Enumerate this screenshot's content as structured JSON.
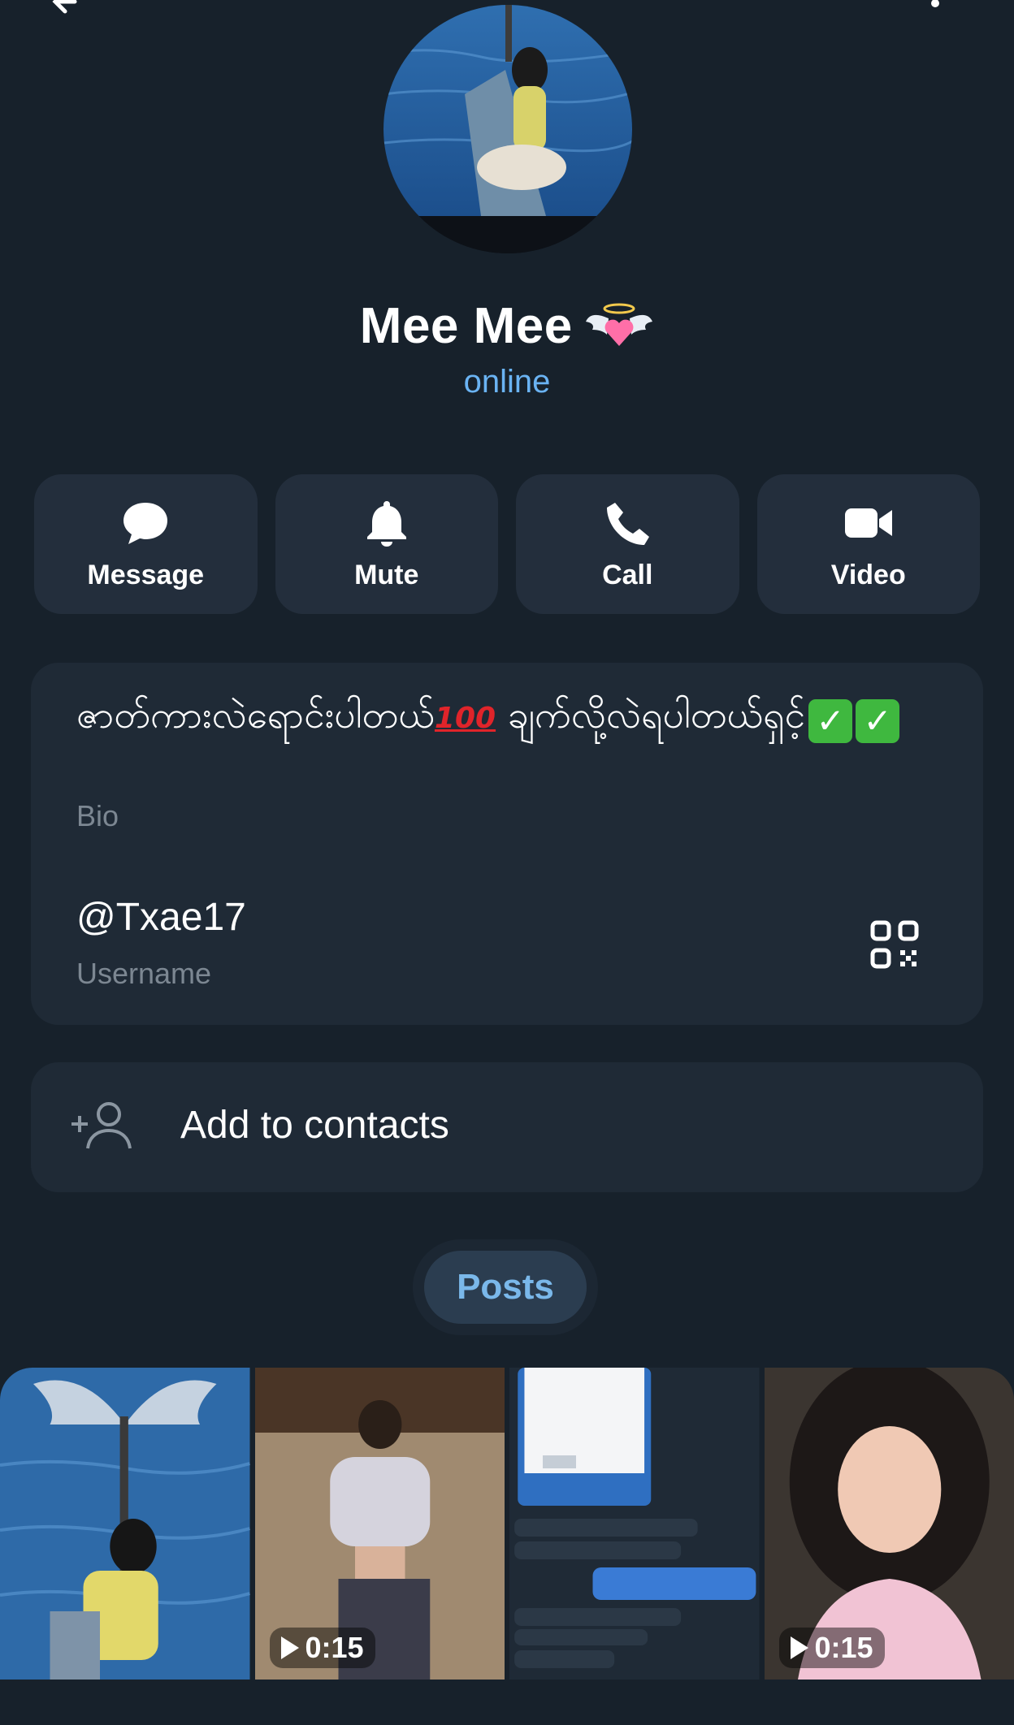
{
  "header": {
    "back_icon": "arrow-left-icon",
    "menu_icon": "more-vertical-icon"
  },
  "profile": {
    "name": "Mee Mee",
    "name_emoji": "heart-with-wings",
    "status": "online",
    "status_color": "#6ab3f3"
  },
  "actions": [
    {
      "label": "Message",
      "icon": "chat-bubble-icon"
    },
    {
      "label": "Mute",
      "icon": "bell-icon"
    },
    {
      "label": "Call",
      "icon": "phone-icon"
    },
    {
      "label": "Video",
      "icon": "video-camera-icon"
    }
  ],
  "info": {
    "bio_text_1": "ဇာတ်ကားလဲရောင်းပါတယ်",
    "bio_emoji_1": "100",
    "bio_text_2": " ချက်လို့လဲရပါတယ်ရှင့်",
    "bio_check": "✓",
    "bio_label": "Bio",
    "username": "@Txae17",
    "username_label": "Username",
    "qr_icon": "qr-code-icon"
  },
  "contact": {
    "label": "Add to contacts",
    "icon": "add-person-icon"
  },
  "tabs": {
    "posts": "Posts"
  },
  "posts": [
    {
      "kind": "photo"
    },
    {
      "kind": "video",
      "duration": "0:15"
    },
    {
      "kind": "screenshot"
    },
    {
      "kind": "video",
      "duration": "0:15"
    }
  ],
  "colors": {
    "background": "#17212b",
    "card": "#1f2a36",
    "button": "#232e3c",
    "accent": "#6ab3f3"
  }
}
